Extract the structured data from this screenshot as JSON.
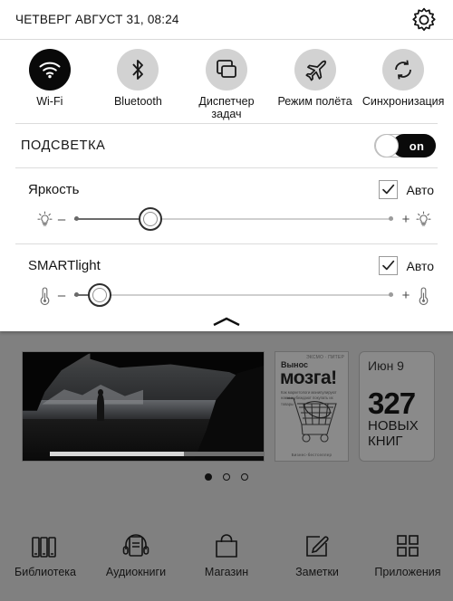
{
  "statusbar": {
    "datetime": "ЧЕТВЕРГ АВГУСТ  31, 08:24",
    "settings_icon": "gear-icon"
  },
  "quick_toggles": [
    {
      "label": "Wi-Fi",
      "icon": "wifi-icon",
      "active": true
    },
    {
      "label": "Bluetooth",
      "icon": "bluetooth-icon",
      "active": false
    },
    {
      "label": "Диспетчер задач",
      "icon": "task-manager-icon",
      "active": false
    },
    {
      "label": "Режим полёта",
      "icon": "airplane-icon",
      "active": false
    },
    {
      "label": "Синхронизация",
      "icon": "sync-icon",
      "active": false
    }
  ],
  "backlight": {
    "label": "ПОДСВЕТКА",
    "switch_state": "on"
  },
  "brightness": {
    "title": "Яркость",
    "auto_label": "Авто",
    "auto_checked": true,
    "value_percent": 24,
    "min_icon": "lightbulb-icon",
    "max_icon": "lightbulb-icon",
    "minus": "–",
    "plus": "+"
  },
  "smartlight": {
    "title": "SMARTlight",
    "auto_label": "Авто",
    "auto_checked": true,
    "value_percent": 8,
    "min_icon": "thermometer-icon",
    "max_icon": "thermometer-icon",
    "minus": "–",
    "plus": "+"
  },
  "panel_handle_icon": "chevron-up-icon",
  "carousel": {
    "photo_card": {
      "name": "photo-card"
    },
    "book_card": {
      "publisher_line": "ЭКСМО · ПИТЕР",
      "title_small": "Вынос",
      "title_big": "мозга!",
      "subtitle": "Как маркетологи манипулируют нами и убеждают покупать их товары",
      "footer": "Бизнес-бестселлер"
    },
    "news_card": {
      "date": "Июн  9",
      "number": "327",
      "line1": "НОВЫХ",
      "line2": "КНИГ"
    },
    "dots": {
      "count": 3,
      "active_index": 0
    }
  },
  "bottom_nav": [
    {
      "label": "Библиотека",
      "icon": "books-icon"
    },
    {
      "label": "Аудиокниги",
      "icon": "headphones-book-icon"
    },
    {
      "label": "Магазин",
      "icon": "shopping-bag-icon"
    },
    {
      "label": "Заметки",
      "icon": "note-pencil-icon"
    },
    {
      "label": "Приложения",
      "icon": "grid-apps-icon"
    }
  ],
  "colors": {
    "background": "#808080",
    "panel": "#ffffff",
    "accent_active": "#090909",
    "toggle_inactive": "#d2d2d2"
  }
}
